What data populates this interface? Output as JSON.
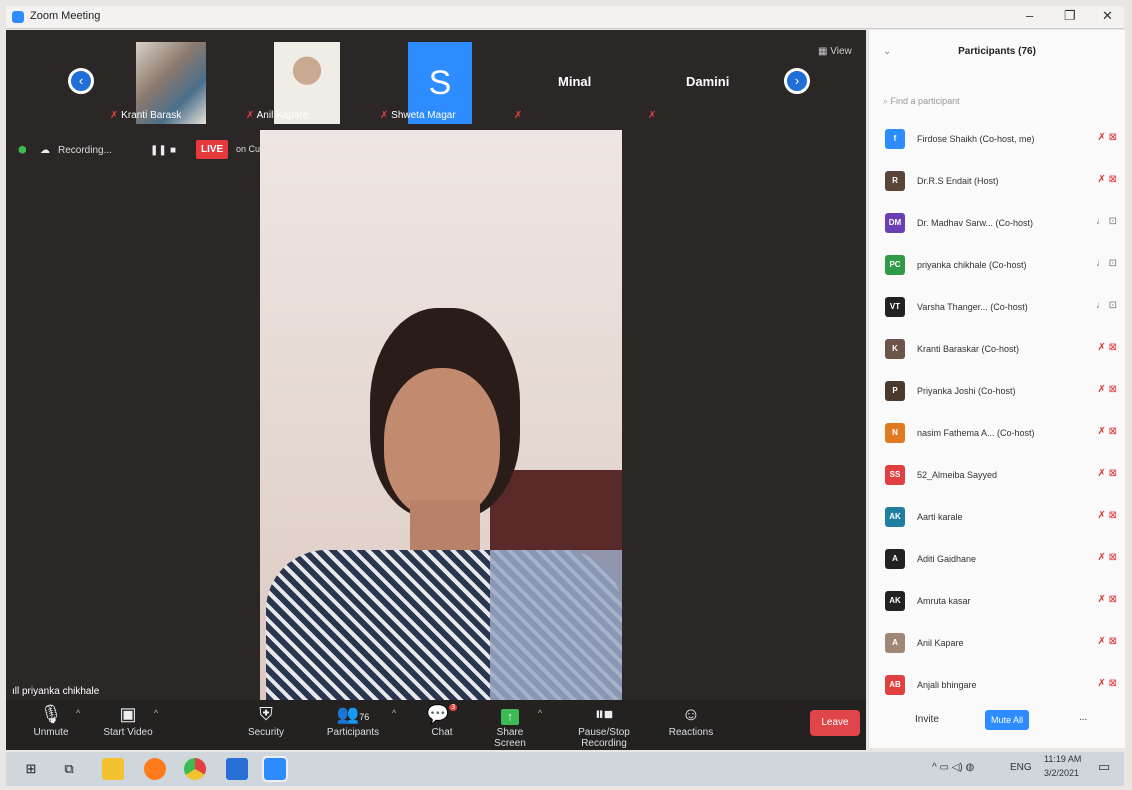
{
  "window": {
    "title": "Zoom Meeting",
    "minimize": "–",
    "restore": "❐",
    "close": "✕"
  },
  "strip": {
    "prev": "‹",
    "next": "›",
    "view_label": "View",
    "thumbs": [
      {
        "name": "Kranti Barask",
        "color": "#8c7a6e"
      },
      {
        "name": "Anil Kapare",
        "color": "#b9a797"
      },
      {
        "name": "Shweta Magar",
        "letter": "S",
        "color": "#2d8cff"
      }
    ],
    "named_tiles": [
      "Minal",
      "Damini"
    ]
  },
  "recording": {
    "label": "Recording...",
    "live_label": "LIVE",
    "stream_label": "on Custom Live Streaming Service"
  },
  "speaker": {
    "name": "priyanka chikhale"
  },
  "toolbar": {
    "unmute": "Unmute",
    "start_video": "Start Video",
    "security": "Security",
    "participants": "Participants",
    "participants_count": "76",
    "chat": "Chat",
    "chat_badge": "3",
    "share_screen": "Share Screen",
    "pause_recording": "Pause/Stop Recording",
    "reactions": "Reactions",
    "leave": "Leave"
  },
  "participants_panel": {
    "title": "Participants (76)",
    "search_placeholder": "Find a participant",
    "rows": [
      {
        "name": "Firdose Shaikh (Co-host, me)",
        "initials": "f",
        "color": "#2d8cff"
      },
      {
        "name": "Dr.R.S Endait (Host)",
        "initials": "R",
        "color": "#5a4638"
      },
      {
        "name": "Dr. Madhav Sarw... (Co-host)",
        "initials": "DM",
        "color": "#6a3fb5"
      },
      {
        "name": "priyanka chikhale (Co-host)",
        "initials": "PC",
        "color": "#2f9a4a"
      },
      {
        "name": "Varsha  Thanger... (Co-host)",
        "initials": "VT",
        "color": "#222222"
      },
      {
        "name": "Kranti Baraskar (Co-host)",
        "initials": "K",
        "color": "#6b5548"
      },
      {
        "name": "Priyanka Joshi (Co-host)",
        "initials": "P",
        "color": "#4a3a2e"
      },
      {
        "name": "nasim Fathema A... (Co-host)",
        "initials": "N",
        "color": "#e07a20"
      },
      {
        "name": "52_Almeiba Sayyed",
        "initials": "SS",
        "color": "#e04040"
      },
      {
        "name": "Aarti karale",
        "initials": "AK",
        "color": "#1f7fa0"
      },
      {
        "name": "Aditi Gaidhane",
        "initials": "A",
        "color": "#222222"
      },
      {
        "name": "Amruta kasar",
        "initials": "AK",
        "color": "#222222"
      },
      {
        "name": "Anil Kapare",
        "initials": "A",
        "color": "#a08878"
      },
      {
        "name": "Anjali bhingare",
        "initials": "AB",
        "color": "#e04040"
      }
    ],
    "invite": "Invite",
    "mute_all": "Mute All",
    "more": "..."
  },
  "taskbar": {
    "tray_lang": "ENG",
    "time": "11:19 AM",
    "date": "3/2/2021"
  }
}
